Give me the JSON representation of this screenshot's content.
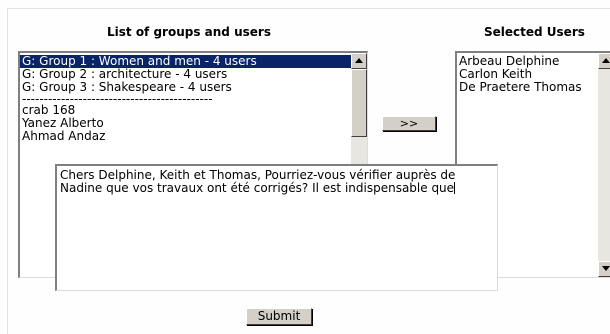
{
  "headings": {
    "groups_users": "List of groups and users",
    "selected_users": "Selected Users"
  },
  "available_list": {
    "groups": [
      {
        "label": "G: Group 1 : Women and men - 4 users",
        "selected": true
      },
      {
        "label": "G: Group 2 : architecture - 4 users",
        "selected": false
      },
      {
        "label": "G: Group 3 : Shakespeare - 4 users",
        "selected": false
      }
    ],
    "separator": "--------------------------------------------",
    "users": [
      "crab 168",
      "Yanez Alberto",
      "Ahmad Andaz"
    ]
  },
  "move_button": {
    "label": ">>"
  },
  "selected_list": {
    "users": [
      "Arbeau Delphine",
      "Carlon Keith",
      "De Praetere Thomas"
    ]
  },
  "message": {
    "value": "Chers Delphine, Keith et Thomas, Pourriez-vous vérifier auprès de Nadine que vos travaux ont été corrigés? Il est indispensable que"
  },
  "submit_button": {
    "label": "Submit"
  },
  "icons": {
    "scroll_up": "triangle-up-icon",
    "scroll_down": "triangle-down-icon"
  }
}
